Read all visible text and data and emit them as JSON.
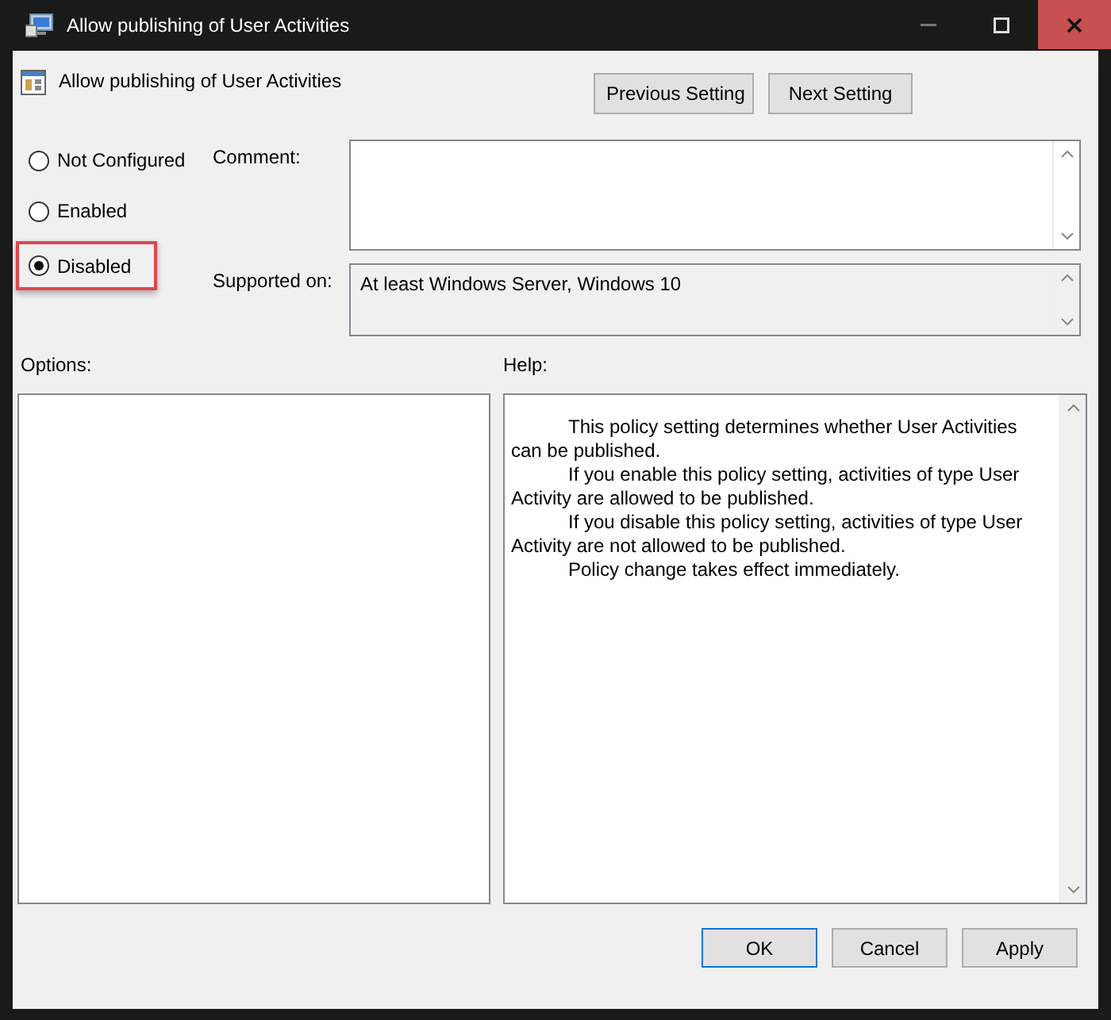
{
  "window": {
    "title": "Allow publishing of User Activities"
  },
  "header": {
    "title": "Allow publishing of User Activities",
    "buttons": [
      "Previous Setting",
      "Next Setting"
    ]
  },
  "states": [
    {
      "label": "Not Configured",
      "selected": false,
      "highlighted": false
    },
    {
      "label": "Enabled",
      "selected": false,
      "highlighted": false
    },
    {
      "label": "Disabled",
      "selected": true,
      "highlighted": true
    }
  ],
  "comment": {
    "label": "Comment:"
  },
  "supported": {
    "label": "Supported on:",
    "value": "At least Windows Server, Windows 10"
  },
  "options": {
    "label": "Options:"
  },
  "help": {
    "label": "Help:",
    "paragraphs": [
      "This policy setting determines whether User Activities can be published.",
      "If you enable this policy setting, activities of type User Activity are allowed to be published.",
      "If you disable this policy setting, activities of type User Activity are not allowed to be published.",
      "Policy change takes effect immediately."
    ]
  },
  "buttons": [
    {
      "label": "OK",
      "kind": "default"
    },
    {
      "label": "Cancel",
      "kind": "normal"
    },
    {
      "label": "Apply",
      "kind": "normal"
    }
  ]
}
